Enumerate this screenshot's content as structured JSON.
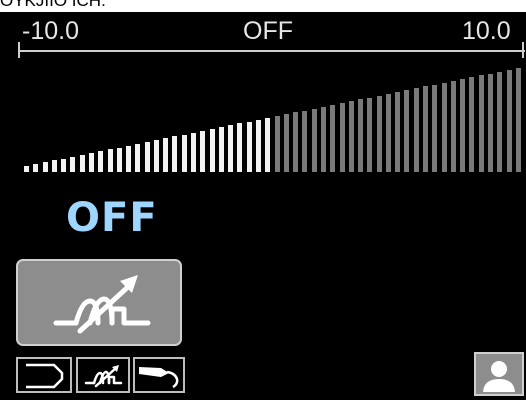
{
  "top_caption": "OYKJIIO ICH.",
  "scale": {
    "min_label": "-10.0",
    "center_label": "OFF",
    "max_label": "10.0"
  },
  "bar_graph": {
    "bar_count": 54,
    "active_count": 27,
    "level": 0.5,
    "colors": {
      "active": "#f2f2f2",
      "inactive": "#7a7a7a"
    }
  },
  "status": {
    "value": "OFF",
    "color": "#9fd6ff"
  },
  "process_button": {
    "icon": "process-ramp-icon"
  },
  "bottom_tabs": [
    {
      "name": "arc-tab",
      "icon": "bracket-icon"
    },
    {
      "name": "process-tab",
      "icon": "process-ramp-icon"
    },
    {
      "name": "torch-tab",
      "icon": "welding-torch-icon"
    }
  ],
  "user_button": {
    "icon": "user-icon"
  }
}
